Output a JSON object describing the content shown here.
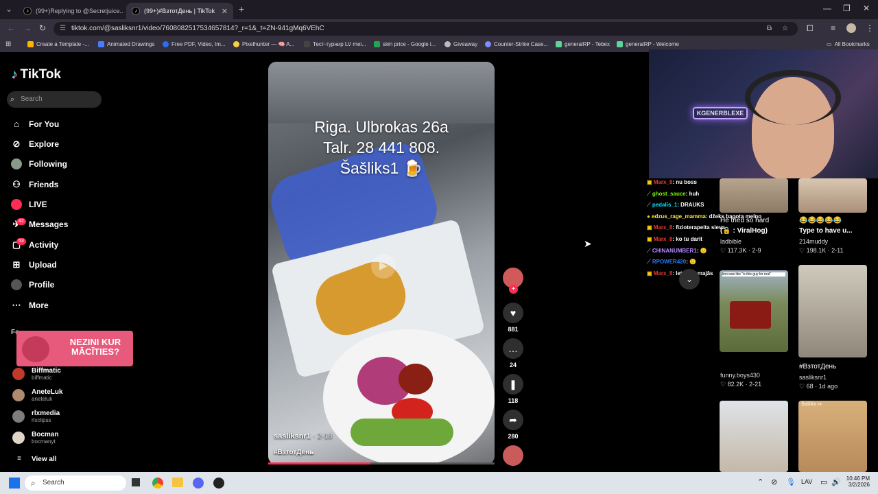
{
  "browser": {
    "tabs": [
      {
        "title": "(99+)Replying to @Secretjuice..."
      },
      {
        "title": "(99+)#ВзтотДень | TikTok"
      }
    ],
    "url": "tiktok.com/@sasliksnr1/video/7608082517534657814?_r=1&_t=ZN-941gMq6VEhC",
    "bookmarks": [
      {
        "label": "Create a Template -...",
        "color": "#ffb400"
      },
      {
        "label": "Animated Drawings",
        "color": "#4a7cff"
      },
      {
        "label": "Free PDF, Video, Im...",
        "color": "#2a6df4"
      },
      {
        "label": "Pixelhunter — 🧠 A...",
        "color": "#f7d04a"
      },
      {
        "label": "Тест-турнир LV mei...",
        "color": "#444"
      },
      {
        "label": "skin price - Google i...",
        "color": "#23a455"
      },
      {
        "label": "Giveaway",
        "color": "#bbbbbb"
      },
      {
        "label": "Counter-Strike Case...",
        "color": "#7d8cff"
      },
      {
        "label": "generalRP - Tebex",
        "color": "#5fd39a"
      },
      {
        "label": "generalRP - Welcome",
        "color": "#5fd39a"
      }
    ],
    "all_bookmarks": "All Bookmarks"
  },
  "sidebar": {
    "logo": "TikTok",
    "search_placeholder": "Search",
    "nav": [
      {
        "label": "For You",
        "icon": "home-icon"
      },
      {
        "label": "Explore",
        "icon": "compass-icon"
      },
      {
        "label": "Following",
        "icon": "following-avatar-icon"
      },
      {
        "label": "Friends",
        "icon": "friends-icon"
      },
      {
        "label": "LIVE",
        "icon": "live-icon"
      },
      {
        "label": "Messages",
        "icon": "messages-icon",
        "badge": "42"
      },
      {
        "label": "Activity",
        "icon": "activity-icon",
        "badge": "53"
      },
      {
        "label": "Upload",
        "icon": "upload-icon"
      },
      {
        "label": "Profile",
        "icon": "profile-icon"
      },
      {
        "label": "More",
        "icon": "more-icon"
      }
    ],
    "following_header": "Fo",
    "promo_text": "NEZINI KUR MĀCĪTIES?",
    "accounts": [
      {
        "name": "Biffmatic",
        "handle": "biffmatic"
      },
      {
        "name": "AneteLuk",
        "handle": "aneteluk"
      },
      {
        "name": "rlxmedia",
        "handle": "rlxclipss"
      },
      {
        "name": "Bocman",
        "handle": "bocmanyt"
      }
    ],
    "view_all": "View all"
  },
  "video": {
    "overlay_line1": "Riga. Ulbrokas 26a",
    "overlay_line2": "Talr. 28 441 808.",
    "overlay_line3": "Šašliks1 🍺",
    "author": "sasliksnr1",
    "date": "· 2-18",
    "hashtag": "#ВзтотДень",
    "progress": 0.45,
    "likes": "881",
    "comments": "24",
    "saves": "118",
    "shares": "280"
  },
  "chat": [
    {
      "user": "Marx_8",
      "msg": ": nu boss",
      "color": "#e53935"
    },
    {
      "user": "ghost_sauce",
      "msg": ": huh",
      "color": "#7cfc00"
    },
    {
      "user": "pedalis_1",
      "msg": ": DRAUKS",
      "color": "#00e5ff"
    },
    {
      "user": "edzus_rage_mamma",
      "msg": ": džeks bagota melno",
      "color": "#ffeb3b"
    },
    {
      "user": "Marx_8",
      "msg": ": fizioterapeita sieva",
      "color": "#e53935"
    },
    {
      "user": "Marx_8",
      "msg": ": ko tu darit",
      "color": "#e53935"
    },
    {
      "user": "CHINANUMBER1",
      "msg": ": 🙂",
      "color": "#b388ff"
    },
    {
      "user": "RPOWER420",
      "msg": ": 🙂",
      "color": "#2979ff"
    },
    {
      "user": "Marx_8",
      "msg": ": letak ka majās",
      "color": "#e53935"
    }
  ],
  "grid": [
    {
      "title": "He tried so hard",
      "sub": "(🔒 : ViralHog)",
      "author": "ladbible",
      "views": "117.3K",
      "date": "2-9"
    },
    {
      "title": "😂😂😂😂😂",
      "sub": "Type to have u...",
      "author": "214muddy",
      "views": "198.1K",
      "date": "2-11"
    },
    {
      "caption": "lion was like \"is this guy for real\"",
      "author": "funny.boys430",
      "views": "82.2K",
      "date": "2-21"
    },
    {
      "title": "#ВзтотДень",
      "author": "sasliksnr1",
      "views": "68",
      "date": "1d ago"
    },
    {
      "caption": "Šašliks nr"
    }
  ],
  "webcam": {
    "sign_text": "KGENERBLEXE"
  },
  "taskbar": {
    "search": "Search",
    "lang": "LAV",
    "time": "10:46 PM",
    "date": "3/2/2026"
  }
}
